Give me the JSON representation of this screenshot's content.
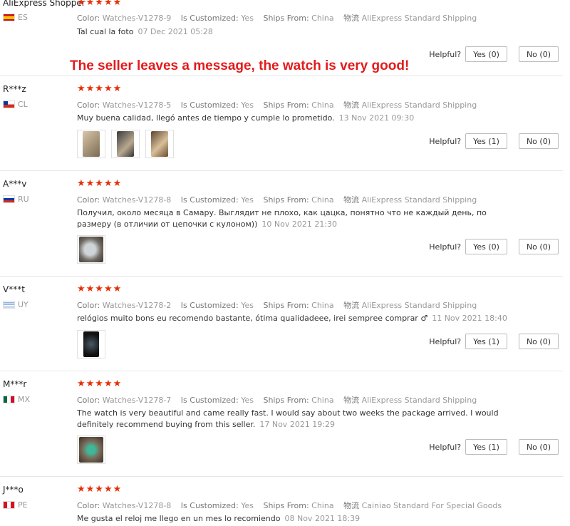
{
  "banner": "The seller leaves a message, the watch is very good!",
  "labels": {
    "color": "Color:",
    "customized": "Is Customized:",
    "ships": "Ships From:",
    "logistics": "物流",
    "helpful": "Helpful?",
    "stars": "★★★★★"
  },
  "reviews": [
    {
      "user": "AliExpress Shopper",
      "country": "ES",
      "color": "Watches-V1278-9",
      "customized": "Yes",
      "ships": "China",
      "shipping": "AliExpress Standard Shipping",
      "text": "Tal cual la foto",
      "date": "07 Dec 2021 05:28",
      "yes": "Yes (0)",
      "no": "No (0)"
    },
    {
      "user": "R***z",
      "country": "CL",
      "color": "Watches-V1278-5",
      "customized": "Yes",
      "ships": "China",
      "shipping": "AliExpress Standard Shipping",
      "text": "Muy buena calidad, llegó antes de tiempo y cumple lo prometido.",
      "date": "13 Nov 2021 09:30",
      "yes": "Yes (1)",
      "no": "No (0)"
    },
    {
      "user": "A***v",
      "country": "RU",
      "color": "Watches-V1278-8",
      "customized": "Yes",
      "ships": "China",
      "shipping": "AliExpress Standard Shipping",
      "text": "Получил, около месяца в Самару. Выглядит не плохо, как цацка, понятно что не каждый день, по размеру (в отличии от цепочки с кулоном))",
      "date": "10 Nov 2021 21:30",
      "yes": "Yes (0)",
      "no": "No (0)"
    },
    {
      "user": "V***t",
      "country": "UY",
      "color": "Watches-V1278-2",
      "customized": "Yes",
      "ships": "China",
      "shipping": "AliExpress Standard Shipping",
      "text": "relógios muito bons eu recomendo bastante, ótima qualidadeee, irei semprее comprar ♂",
      "date": "11 Nov 2021 18:40",
      "yes": "Yes (1)",
      "no": "No (0)"
    },
    {
      "user": "M***r",
      "country": "MX",
      "color": "Watches-V1278-7",
      "customized": "Yes",
      "ships": "China",
      "shipping": "AliExpress Standard Shipping",
      "text": "The watch is very beautiful and came really fast. I would say about two weeks the package arrived. I would definitely recommend buying from this seller.",
      "date": "17 Nov 2021 19:29",
      "yes": "Yes (1)",
      "no": "No (0)"
    },
    {
      "user": "J***o",
      "country": "PE",
      "color": "Watches-V1278-8",
      "customized": "Yes",
      "ships": "China",
      "shipping": "Cainiao Standard For Special Goods",
      "text": "Me gusta el reloj me llego en un mes lo recomiendo",
      "date": "08 Nov 2021 18:39"
    }
  ],
  "colors": {
    "star": "#e62e04",
    "banner": "#e31b1b"
  }
}
